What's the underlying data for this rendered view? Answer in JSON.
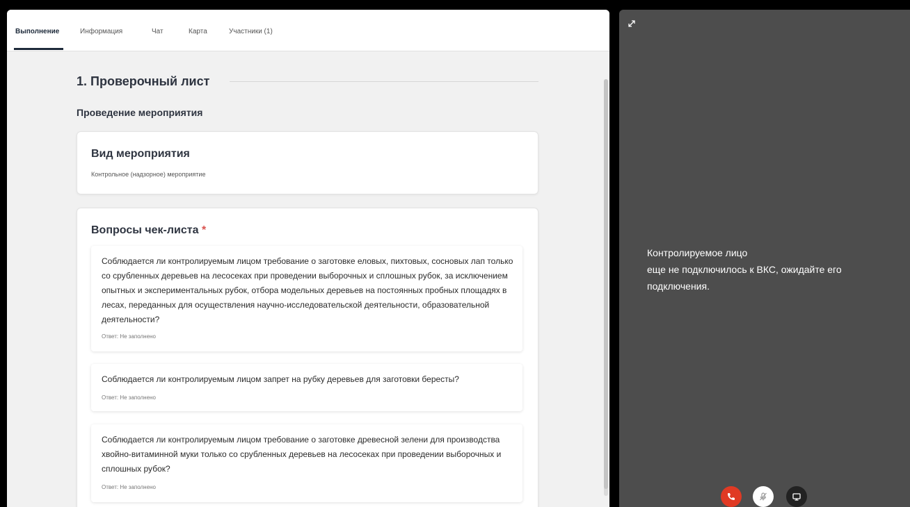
{
  "tabs": [
    {
      "label": "Выполнение",
      "active": true
    },
    {
      "label": "Информация",
      "active": false
    },
    {
      "label": "Чат",
      "active": false
    },
    {
      "label": "Карта",
      "active": false
    },
    {
      "label": "Участники (1)",
      "active": false
    }
  ],
  "section": {
    "title": "1. Проверочный лист",
    "subtitle": "Проведение мероприятия"
  },
  "event_card": {
    "title": "Вид мероприятия",
    "value": "Контрольное (надзорное) мероприятие"
  },
  "questions_card": {
    "title": "Вопросы чек-листа",
    "required_mark": "*",
    "questions": [
      {
        "text": "Соблюдается ли контролируемым лицом требование о заготовке еловых, пихтовых, сосновых лап только со срубленных деревьев на лесосеках при проведении выборочных и сплошных рубок, за исключением опытных и экспериментальных рубок, отбора модельных деревьев на постоянных пробных площадях в лесах, переданных для осуществления научно-исследовательской деятельности, образовательной деятельности?",
        "answer": "Ответ: Не заполнено"
      },
      {
        "text": "Соблюдается ли контролируемым лицом запрет на рубку деревьев для заготовки бересты?",
        "answer": "Ответ: Не заполнено"
      },
      {
        "text": "Соблюдается ли контролируемым лицом требование о заготовке древесной зелени для производства хвойно-витаминной муки только со срубленных деревьев на лесосеках при проведении выборочных и сплошных рубок?",
        "answer": "Ответ: Не заполнено"
      }
    ]
  },
  "video_panel": {
    "status_line1": "Контролируемое лицо",
    "status_line2": "еще не подключилось к ВКС, ожидайте его подключения.",
    "controls": [
      {
        "icon": "phone-hangup-icon",
        "color": "#e03a24"
      },
      {
        "icon": "microphone-muted-icon",
        "color": "#ffffff"
      },
      {
        "icon": "screen-share-icon",
        "color": "#222222"
      }
    ]
  },
  "colors": {
    "accent_dark": "#1d2a3a",
    "required": "#d9534f",
    "video_bg": "#4d4d4d",
    "hangup": "#e03a24"
  }
}
